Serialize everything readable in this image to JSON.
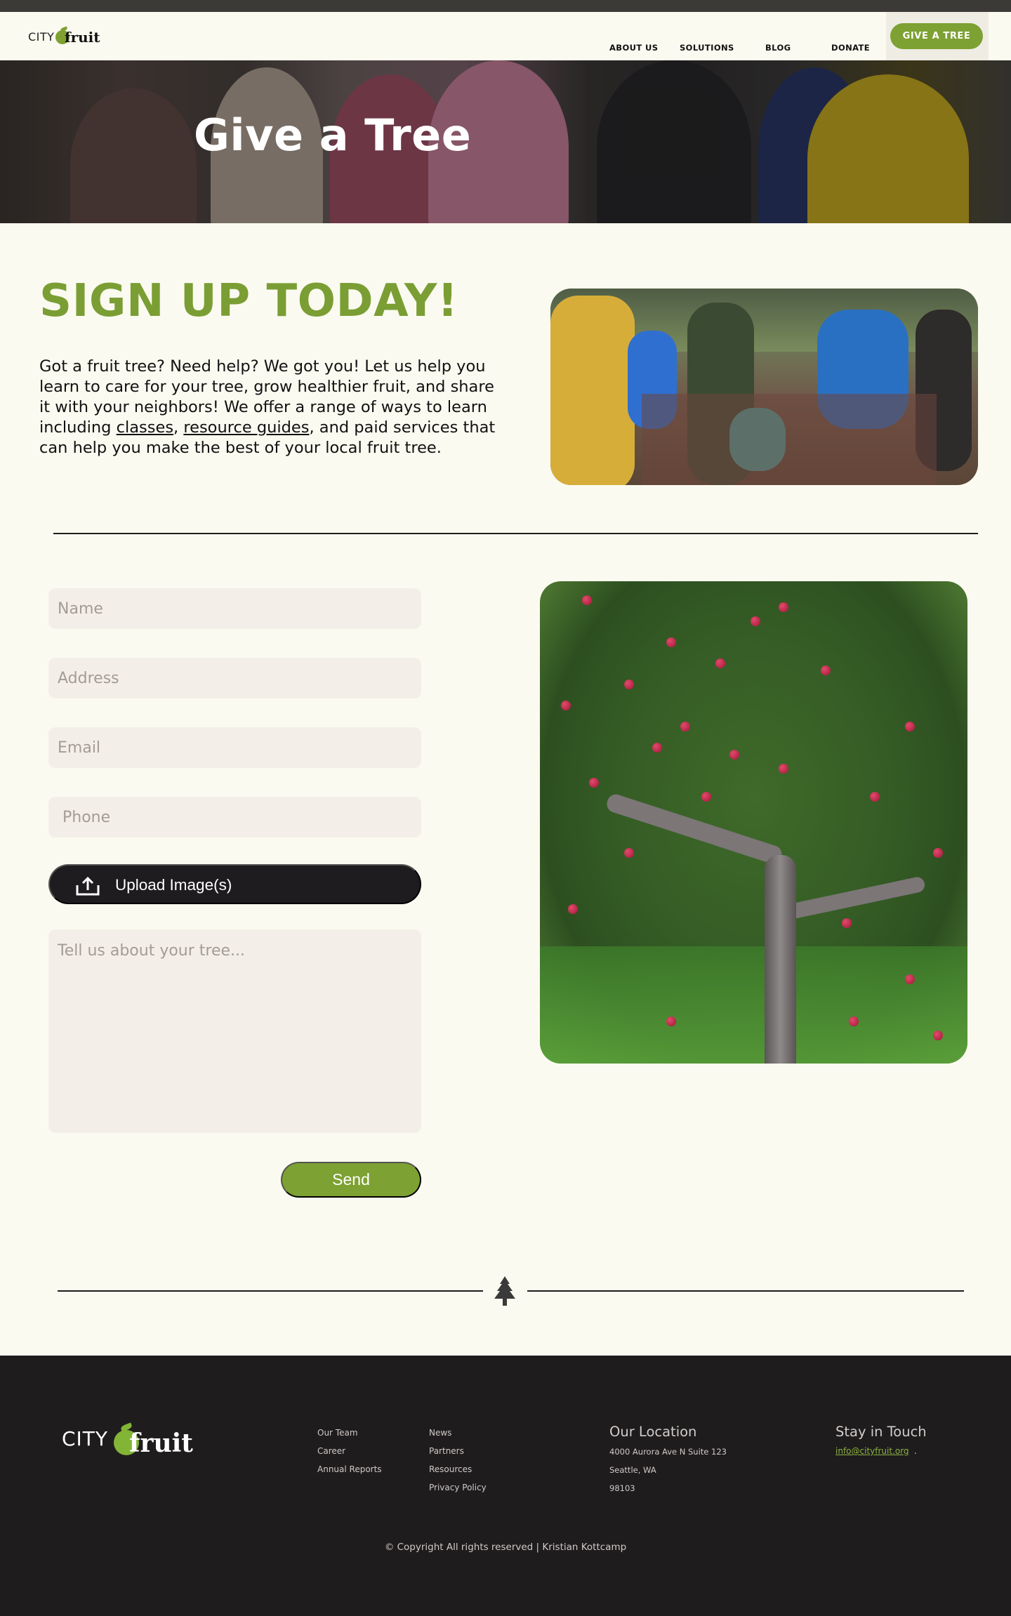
{
  "nav": {
    "logo_city": "CITY",
    "logo_fruit": "fruit",
    "links": [
      "ABOUT US",
      "SOLUTIONS",
      "BLOG",
      "DONATE"
    ],
    "cta": "GIVE A TREE",
    "accent_color": "#7da132"
  },
  "hero": {
    "title": "Give a Tree"
  },
  "signup": {
    "title": "SIGN UP TODAY!",
    "intro_before": "Got a fruit tree? Need help? We got you! Let us help you learn to care for your tree, grow healthier fruit, and share it with your neighbors! We offer a range of ways to learn including ",
    "link_classes": "classes",
    "comma": ", ",
    "link_guides": "resource guides",
    "intro_after": ", and paid services that can help you make the best of your local fruit tree."
  },
  "form": {
    "name_placeholder": "Name",
    "address_placeholder": "Address",
    "email_placeholder": "Email",
    "phone_placeholder": " Phone",
    "upload_label": "Upload Image(s)",
    "upload_icon": "upload-icon",
    "message_placeholder": "Tell us about your tree...",
    "send_label": "Send"
  },
  "divider_icon": "tree-icon",
  "footer": {
    "logo_city": "CITY",
    "logo_fruit": "fruit",
    "col1": [
      "Our Team",
      "Career",
      "Annual Reports"
    ],
    "col2": [
      "News",
      "Partners",
      "Resources",
      "Privacy Policy"
    ],
    "location_heading": "Our Location",
    "address_line1": "4000 Aurora Ave N Suite 123",
    "address_line2": "Seattle, WA",
    "address_line3": " 98103",
    "contact_heading": "Stay in Touch",
    "email": "info@cityfruit.org",
    "email_suffix": ".",
    "copyright": "© Copyright All rights reserved | Kristian Kottcamp"
  }
}
